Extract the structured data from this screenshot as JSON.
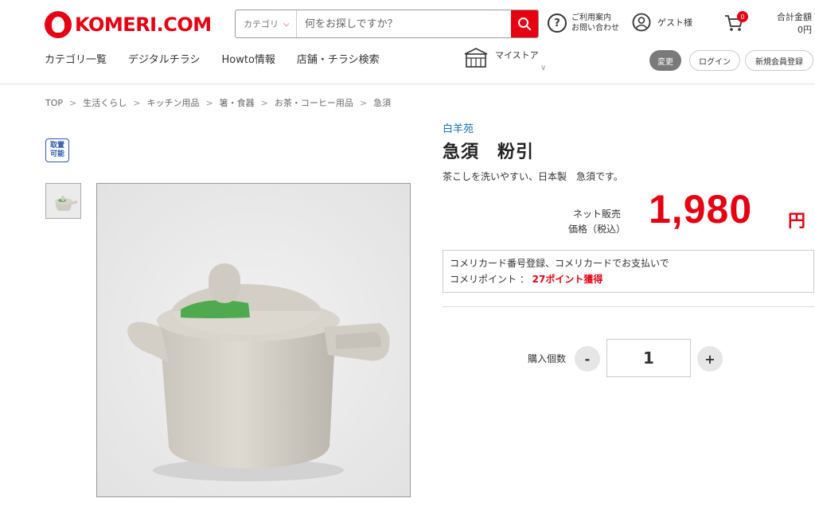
{
  "header": {
    "logo_text": "KOMERI.COM",
    "search": {
      "category_label": "カテゴリ",
      "placeholder": "何をお探しですか？"
    },
    "help_line1": "ご利用案内",
    "help_line2": "お問い合わせ",
    "user_label": "ゲスト様",
    "cart_count": "0",
    "total_label": "合計金額",
    "total_value": "0円",
    "nav": [
      "カテゴリ一覧",
      "デジタルチラシ",
      "Howto情報",
      "店舗・チラシ検索"
    ],
    "mystore_label": "マイストア",
    "change_button": "変更",
    "login_button": "ログイン",
    "register_button": "新規会員登録"
  },
  "breadcrumb": [
    "TOP",
    "生活くらし",
    "キッチン用品",
    "箸・食器",
    "お茶・コーヒー用品",
    "急須"
  ],
  "badge": {
    "line1": "取置",
    "line2": "可能"
  },
  "product": {
    "brand": "白羊苑",
    "title": "急須　粉引",
    "description": "茶こしを洗いやすい、日本製　急須です。",
    "price_label_line1": "ネット販売",
    "price_label_line2": "価格（税込）",
    "price": "1,980",
    "price_unit": "円",
    "points_line1": "コメリカード番号登録、コメリカードでお支払いで",
    "points_prefix": "コメリポイント ： ",
    "points_value": "27ポイント獲得",
    "quantity_label": "購入個数",
    "quantity": "1",
    "minus": "-",
    "plus": "+"
  },
  "colors": {
    "brand_red": "#e60012",
    "brand_blue": "#1a6fb8"
  }
}
